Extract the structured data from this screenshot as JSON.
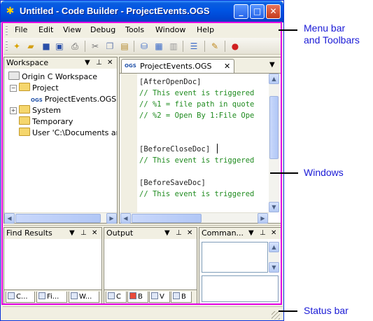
{
  "window": {
    "title": "Untitled - Code Builder - ProjectEvents.OGS",
    "buttons": {
      "minimize": "_",
      "maximize": "□",
      "close": "✕"
    }
  },
  "menu": {
    "items": [
      "File",
      "Edit",
      "View",
      "Debug",
      "Tools",
      "Window",
      "Help"
    ]
  },
  "toolbar": {
    "tools": [
      "new-file-icon",
      "open-folder-icon",
      "save-icon",
      "save-all-icon",
      "print-icon",
      "cut-icon",
      "copy-icon",
      "paste-icon",
      "build-icon",
      "build-all-icon",
      "batch-build-icon",
      "list-icon",
      "edit-icon",
      "stop-icon"
    ]
  },
  "workspace": {
    "title": "Workspace",
    "tree": [
      {
        "label": "Origin C Workspace"
      },
      {
        "label": "Project"
      },
      {
        "label": "ProjectEvents.OGS<"
      },
      {
        "label": "System"
      },
      {
        "label": "Temporary"
      },
      {
        "label": "User 'C:\\Documents and"
      }
    ]
  },
  "editor": {
    "tab": "ProjectEvents.OGS",
    "tab_icon": "OGS",
    "lines": [
      {
        "text": "[AfterOpenDoc]",
        "kind": "normal"
      },
      {
        "text": "// This event is triggered",
        "kind": "comment"
      },
      {
        "text": "// %1 = file path in quote",
        "kind": "comment"
      },
      {
        "text": "// %2 = Open By 1:File Ope",
        "kind": "comment"
      },
      {
        "text": "",
        "kind": "normal"
      },
      {
        "text": "",
        "kind": "normal"
      },
      {
        "text": "[BeforeCloseDoc]",
        "kind": "normal"
      },
      {
        "text": "// This event is triggered",
        "kind": "comment"
      },
      {
        "text": "",
        "kind": "normal"
      },
      {
        "text": "[BeforeSaveDoc]",
        "kind": "normal"
      },
      {
        "text": "// This event is triggered",
        "kind": "comment"
      }
    ]
  },
  "panels": {
    "find_results": "Find Results",
    "output": "Output",
    "command": "Comman..."
  },
  "bottom_tabs": {
    "find": [
      "C...",
      "Fi...",
      "W..."
    ],
    "output": [
      "C",
      "B",
      "V",
      "B"
    ]
  },
  "annotations": {
    "menubar_line1": "Menu bar",
    "menubar_line2": "and Toolbars",
    "windows": "Windows",
    "statusbar": "Status bar"
  },
  "colors": {
    "outline": "#e400e4",
    "annotation": "#1a1ad6",
    "title_bar": "#0054e3",
    "comment": "#1f8b1f"
  }
}
